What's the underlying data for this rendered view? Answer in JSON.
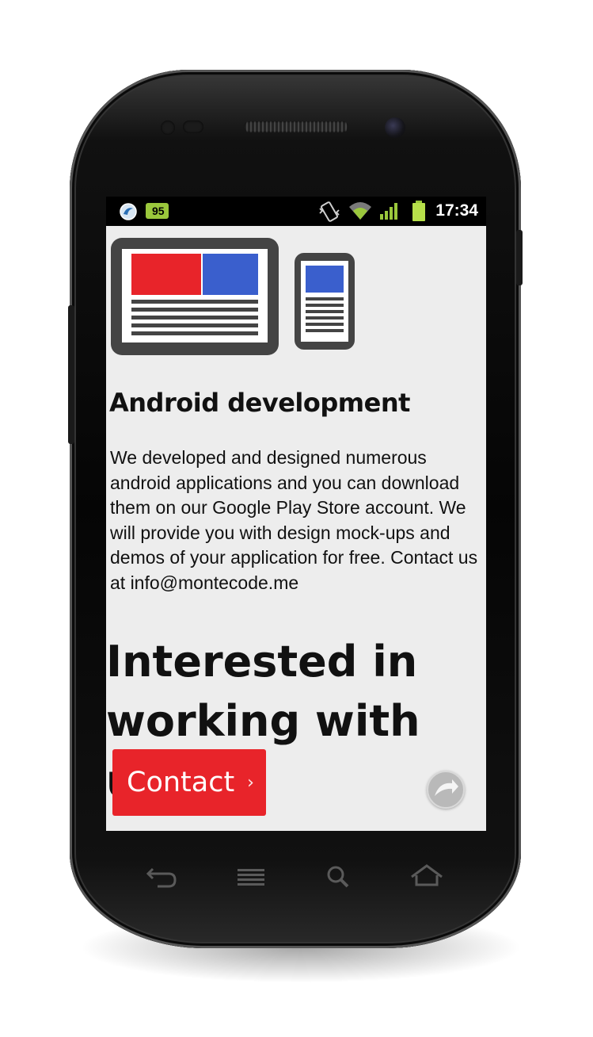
{
  "status_bar": {
    "time": "17:34",
    "notification_badge": "95",
    "icons": [
      "app-notification-icon",
      "vibrate-icon",
      "wifi-icon",
      "signal-icon",
      "battery-icon"
    ]
  },
  "hero": {
    "icons": [
      "tablet-layout-icon",
      "phone-layout-icon"
    ],
    "colors": {
      "red": "#e8242a",
      "blue": "#3a5fcd",
      "device": "#444444"
    }
  },
  "main": {
    "heading": "Android development",
    "body": "We developed and designed numerous android applications and you can download them on our Google Play Store account. We will provide you with design mock-ups and demos of your application for free. Contact us at info@montecode.me",
    "cta_title": "Interested in working with us ?",
    "contact_button_label": "Contact",
    "contact_button_chevron": "›",
    "back_to_top_icon": "scroll-up-icon"
  },
  "nav_keys": [
    "back-key-icon",
    "menu-key-icon",
    "search-key-icon",
    "home-key-icon"
  ],
  "theme": {
    "accent": "#e8242a",
    "background": "#ededed",
    "text": "#111111"
  }
}
